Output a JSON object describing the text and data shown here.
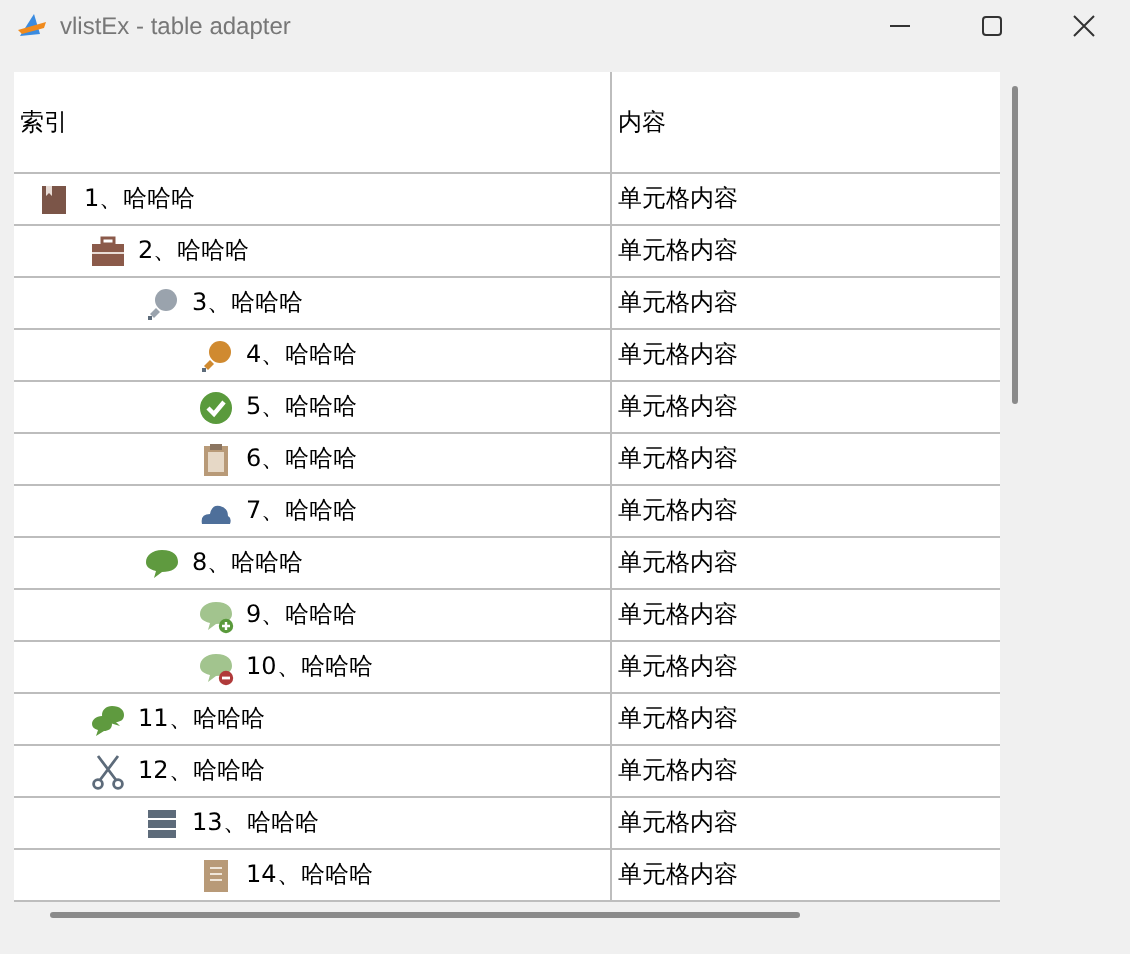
{
  "window": {
    "title": "vlistEx - table adapter"
  },
  "table": {
    "columns": [
      "索引",
      "内容"
    ],
    "rows": [
      {
        "label": "1、哈哈哈",
        "content": "单元格内容",
        "children": [
          {
            "label": "2、哈哈哈",
            "content": "单元格内容",
            "children": [
              {
                "label": "3、哈哈哈",
                "content": "单元格内容",
                "children": [
                  {
                    "label": "4、哈哈哈",
                    "content": "单元格内容"
                  },
                  {
                    "label": "5、哈哈哈",
                    "content": "单元格内容"
                  },
                  {
                    "label": "6、哈哈哈",
                    "content": "单元格内容"
                  },
                  {
                    "label": "7、哈哈哈",
                    "content": "单元格内容"
                  }
                ]
              },
              {
                "label": "8、哈哈哈",
                "content": "单元格内容",
                "children": [
                  {
                    "label": "9、哈哈哈",
                    "content": "单元格内容"
                  },
                  {
                    "label": "10、哈哈哈",
                    "content": "单元格内容"
                  }
                ]
              }
            ]
          },
          {
            "label": "11、哈哈哈",
            "content": "单元格内容"
          },
          {
            "label": "12、哈哈哈",
            "content": "单元格内容",
            "children": [
              {
                "label": "13、哈哈哈",
                "content": "单元格内容",
                "children": [
                  {
                    "label": "14、哈哈哈",
                    "content": "单元格内容"
                  }
                ]
              }
            ]
          }
        ]
      }
    ]
  }
}
